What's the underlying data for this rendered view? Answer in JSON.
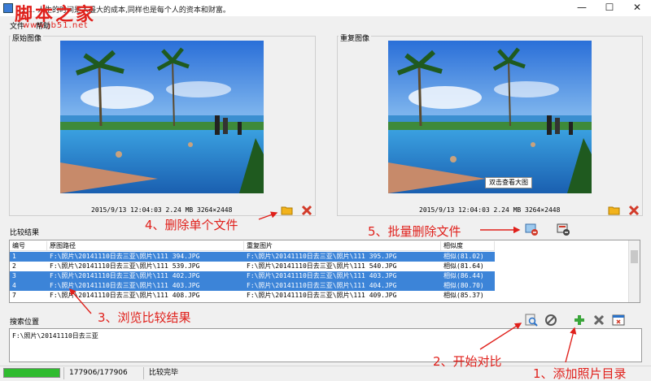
{
  "window": {
    "title": "...... 人生的时间是人最大的成本,同样也是每个人的资本和财富。",
    "minimize_glyph": "—",
    "maximize_glyph": "☐",
    "close_glyph": "✕"
  },
  "watermark": {
    "main": "脚本之家",
    "sub": "www.jb51.net"
  },
  "menu": {
    "file": "文件",
    "help": "帮助"
  },
  "panels": {
    "original": {
      "label": "原始图像",
      "meta": "2015/9/13 12:04:03  2.24 MB  3264×2448"
    },
    "duplicate": {
      "label": "重复图像",
      "meta": "2015/9/13 12:04:03  2.24 MB  3264×2448",
      "tooltip": "双击查看大图"
    }
  },
  "results": {
    "label": "比较结果",
    "columns": [
      "编号",
      "原图路径",
      "重复图片",
      "相似度"
    ],
    "rows": [
      {
        "id": "1",
        "orig": "F:\\照片\\20141110日去三亚\\照片\\111 394.JPG",
        "dup": "F:\\照片\\20141110日去三亚\\照片\\111 395.JPG",
        "sim": "相似(81.02)",
        "selected": true
      },
      {
        "id": "2",
        "orig": "F:\\照片\\20141110日去三亚\\照片\\111 539.JPG",
        "dup": "F:\\照片\\20141110日去三亚\\照片\\111 540.JPG",
        "sim": "相似(81.64)",
        "selected": false
      },
      {
        "id": "3",
        "orig": "F:\\照片\\20141110日去三亚\\照片\\111 402.JPG",
        "dup": "F:\\照片\\20141110日去三亚\\照片\\111 403.JPG",
        "sim": "相似(86.44)",
        "selected": true
      },
      {
        "id": "4",
        "orig": "F:\\照片\\20141110日去三亚\\照片\\111 403.JPG",
        "dup": "F:\\照片\\20141110日去三亚\\照片\\111 404.JPG",
        "sim": "相似(80.70)",
        "selected": true
      },
      {
        "id": "7",
        "orig": "F:\\照片\\20141110日去三亚\\照片\\111 408.JPG",
        "dup": "F:\\照片\\20141110日去三亚\\照片\\111 409.JPG",
        "sim": "相似(85.37)",
        "selected": false
      }
    ]
  },
  "search": {
    "label": "搜索位置",
    "value": "F:\\照片\\20141110日去三亚"
  },
  "status": {
    "progress_text": "177906/177906",
    "progress_fraction": 1.0,
    "state": "比较完毕"
  },
  "annotations": {
    "a1": "1、添加照片目录",
    "a2": "2、开始对比",
    "a3": "3、浏览比较结果",
    "a4": "4、删除单个文件",
    "a5": "5、批量删除文件"
  },
  "colors": {
    "accent_red": "#e0201b",
    "selection_blue": "#3c84d8",
    "progress_green": "#2fbb2f"
  }
}
